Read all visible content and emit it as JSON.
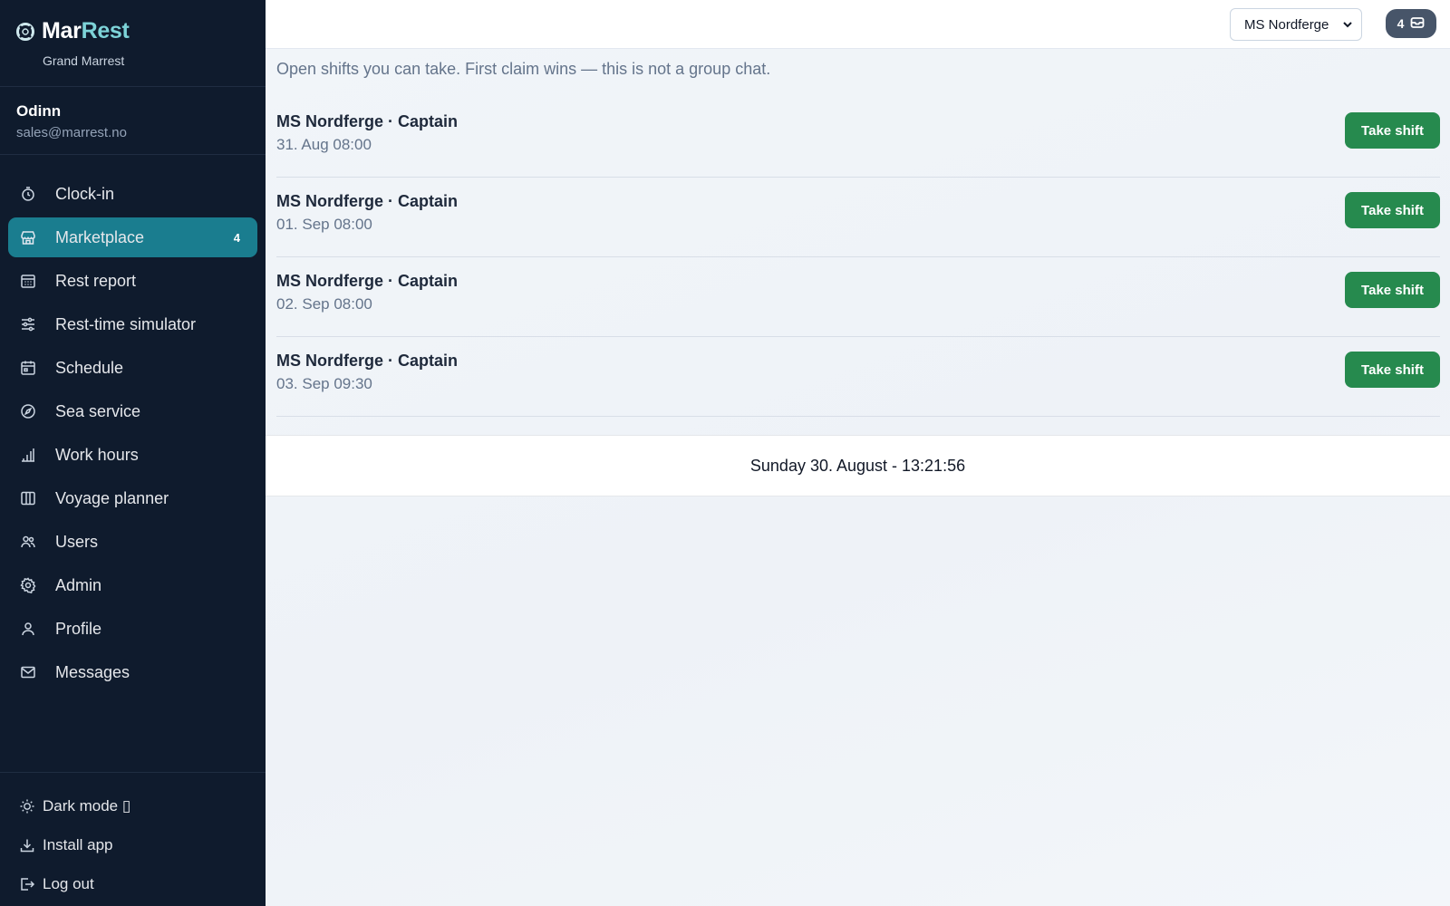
{
  "brand": {
    "name_main": "Mar",
    "name_accent": "Rest",
    "org": "Grand Marrest"
  },
  "user": {
    "name": "Odinn",
    "email": "sales@marrest.no"
  },
  "nav": [
    {
      "label": "Clock-in",
      "icon": "clock-icon"
    },
    {
      "label": "Marketplace",
      "icon": "store-icon",
      "badge": "4",
      "active": true
    },
    {
      "label": "Rest report",
      "icon": "calendar-grid-icon"
    },
    {
      "label": "Rest-time simulator",
      "icon": "sliders-icon"
    },
    {
      "label": "Schedule",
      "icon": "calendar-icon"
    },
    {
      "label": "Sea service",
      "icon": "compass-icon"
    },
    {
      "label": "Work hours",
      "icon": "bar-chart-icon"
    },
    {
      "label": "Voyage planner",
      "icon": "map-icon"
    },
    {
      "label": "Users",
      "icon": "users-icon"
    },
    {
      "label": "Admin",
      "icon": "gear-icon"
    },
    {
      "label": "Profile",
      "icon": "user-icon"
    },
    {
      "label": "Messages",
      "icon": "mail-icon"
    }
  ],
  "bottom": {
    "dark_mode": "Dark mode ▯",
    "install": "Install app",
    "logout": "Log out"
  },
  "topbar": {
    "vessel": "MS Nordferge",
    "inbox_count": "4"
  },
  "main": {
    "intro": "Open shifts you can take. First claim wins — this is not a group chat.",
    "take_label": "Take shift",
    "shifts": [
      {
        "title": "MS Nordferge · Captain",
        "time": "31. Aug 08:00"
      },
      {
        "title": "MS Nordferge · Captain",
        "time": "01. Sep 08:00"
      },
      {
        "title": "MS Nordferge · Captain",
        "time": "02. Sep 08:00"
      },
      {
        "title": "MS Nordferge · Captain",
        "time": "03. Sep 09:30"
      }
    ],
    "clock": "Sunday 30. August - 13:21:56"
  },
  "colors": {
    "sidebar": "#0f1b2d",
    "accent": "#1a7d8f",
    "action": "#268a4e",
    "brand_accent": "#7dd3d8"
  }
}
